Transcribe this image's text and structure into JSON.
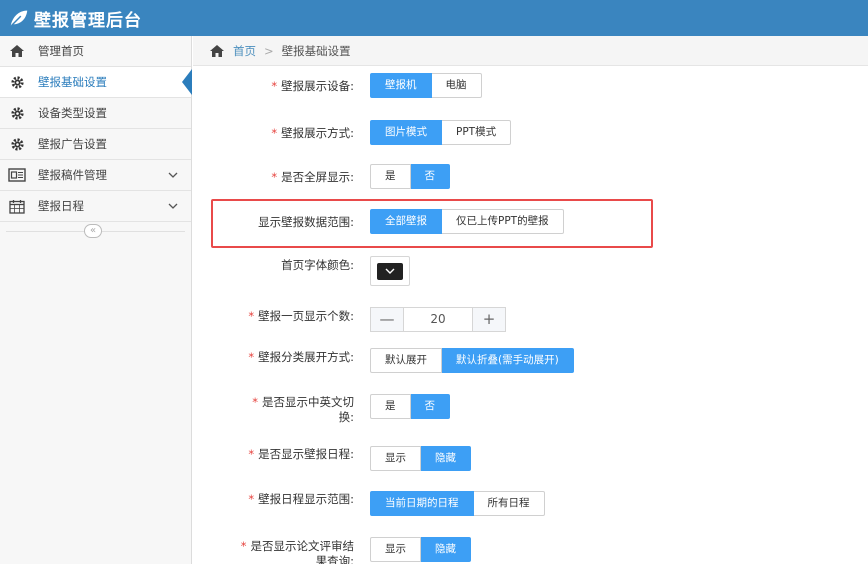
{
  "header": {
    "title": "壁报管理后台",
    "logo_icon": "leaf-icon"
  },
  "sidebar": {
    "items": [
      {
        "label": "管理首页",
        "icon": "home-icon",
        "active": false,
        "expandable": false
      },
      {
        "label": "壁报基础设置",
        "icon": "gear-icon",
        "active": true,
        "expandable": false
      },
      {
        "label": "设备类型设置",
        "icon": "gear-icon",
        "active": false,
        "expandable": false
      },
      {
        "label": "壁报广告设置",
        "icon": "gear-icon",
        "active": false,
        "expandable": false
      },
      {
        "label": "壁报稿件管理",
        "icon": "newspaper-icon",
        "active": false,
        "expandable": true
      },
      {
        "label": "壁报日程",
        "icon": "calendar-icon",
        "active": false,
        "expandable": true
      }
    ],
    "collapse_glyph": "«"
  },
  "breadcrumb": {
    "home": "首页",
    "separator": ">",
    "current": "壁报基础设置"
  },
  "form": {
    "required_mark": "*",
    "display_device": {
      "label": "壁报展示设备:",
      "options": [
        "壁报机",
        "电脑"
      ],
      "selected": 0
    },
    "display_mode": {
      "label": "壁报展示方式:",
      "options": [
        "图片模式",
        "PPT模式"
      ],
      "selected": 0
    },
    "fullscreen": {
      "label": "是否全屏显示:",
      "options": [
        "是",
        "否"
      ],
      "selected": 1
    },
    "data_range": {
      "label": "显示壁报数据范围:",
      "options": [
        "全部壁报",
        "仅已上传PPT的壁报"
      ],
      "selected": 0
    },
    "font_color": {
      "label": "首页字体颜色:",
      "value": "#222222"
    },
    "per_page": {
      "label": "壁报一页显示个数:",
      "value": "20",
      "minus": "—",
      "plus": "+"
    },
    "category_expand": {
      "label": "壁报分类展开方式:",
      "options": [
        "默认展开",
        "默认折叠(需手动展开)"
      ],
      "selected": 1
    },
    "lang_switch": {
      "label_line1": "是否显示中英文切",
      "label_line2": "换:",
      "options": [
        "是",
        "否"
      ],
      "selected": 1
    },
    "show_schedule": {
      "label": "是否显示壁报日程:",
      "options": [
        "显示",
        "隐藏"
      ],
      "selected": 1
    },
    "schedule_range": {
      "label": "壁报日程显示范围:",
      "options": [
        "当前日期的日程",
        "所有日程"
      ],
      "selected": 0
    },
    "review_query": {
      "label_line1": "是否显示论文评审结",
      "label_line2": "果查询:",
      "options": [
        "显示",
        "隐藏"
      ],
      "selected": 1
    }
  },
  "colors": {
    "header": "#3a85bf",
    "accent": "#3d9ff5",
    "required": "#e6413c",
    "highlight": "#e94a4a"
  }
}
